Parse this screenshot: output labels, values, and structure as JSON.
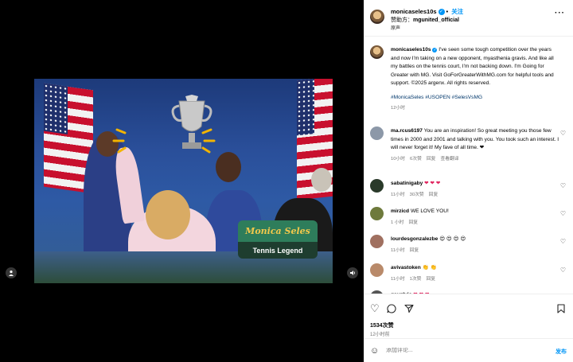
{
  "video": {
    "badge_name": "Monica Seles",
    "badge_sub": "Tennis Legend",
    "user_tag_icon": "person-icon",
    "sound_icon": "speaker-icon"
  },
  "header": {
    "username": "monicaseles10s",
    "follow": "关注",
    "separator": "•",
    "sponsor_label": "赞助方：",
    "sponsor_name": "mgunited_official",
    "audio": "原声",
    "more": "···"
  },
  "caption": {
    "username": "monicaseles10s",
    "text": "I've seen some tough competition over the years and now I'm taking on a new opponent, myasthenia gravis. And like all my battles on the tennis court, I'm not backing down. I'm Going for Greater with MG. Visit GoForGreaterWithMG.com for helpful tools and support. ©2025 argenx. All rights reserved.",
    "hashtags": "#MonicaSeles #USOPEN #SelesVsMG",
    "time": "12小时"
  },
  "comments": [
    {
      "username": "ma.rcus6197",
      "text": "You are an inspiration! So great meeting you those few times in 2000 and 2001 and talking with you. You took such an interest. I will never forget it! My fave of all time. ❤",
      "time": "10小时",
      "likes": "6次赞",
      "reply": "回复",
      "translate": "查看翻译"
    },
    {
      "username": "sabatinigaby",
      "text": "❤ ❤ ❤",
      "time": "11小时",
      "likes": "30次赞",
      "reply": "回复"
    },
    {
      "username": "mirzicd",
      "text": "WE LOVE YOU!",
      "time": "1 小时",
      "reply": "回复"
    },
    {
      "username": "lourdesgonzalezbe",
      "text": "😍 😍 😍 😍",
      "time": "11小时",
      "reply": "回复"
    },
    {
      "username": "avivastoken",
      "text": "👏 👏",
      "time": "11小时",
      "likes": "1次赞",
      "reply": "回复"
    },
    {
      "username": "gavglvic",
      "text": "❤ ❤ ❤"
    }
  ],
  "actions": {
    "likes": "1534次赞",
    "time": "12小时前"
  },
  "composer": {
    "placeholder": "添加评论...",
    "post": "发布"
  },
  "colors": {
    "accent": "#0095f6",
    "badge_green": "#2e7d5b",
    "badge_dark": "#1e3d2f",
    "badge_gold": "#f2c84b"
  }
}
